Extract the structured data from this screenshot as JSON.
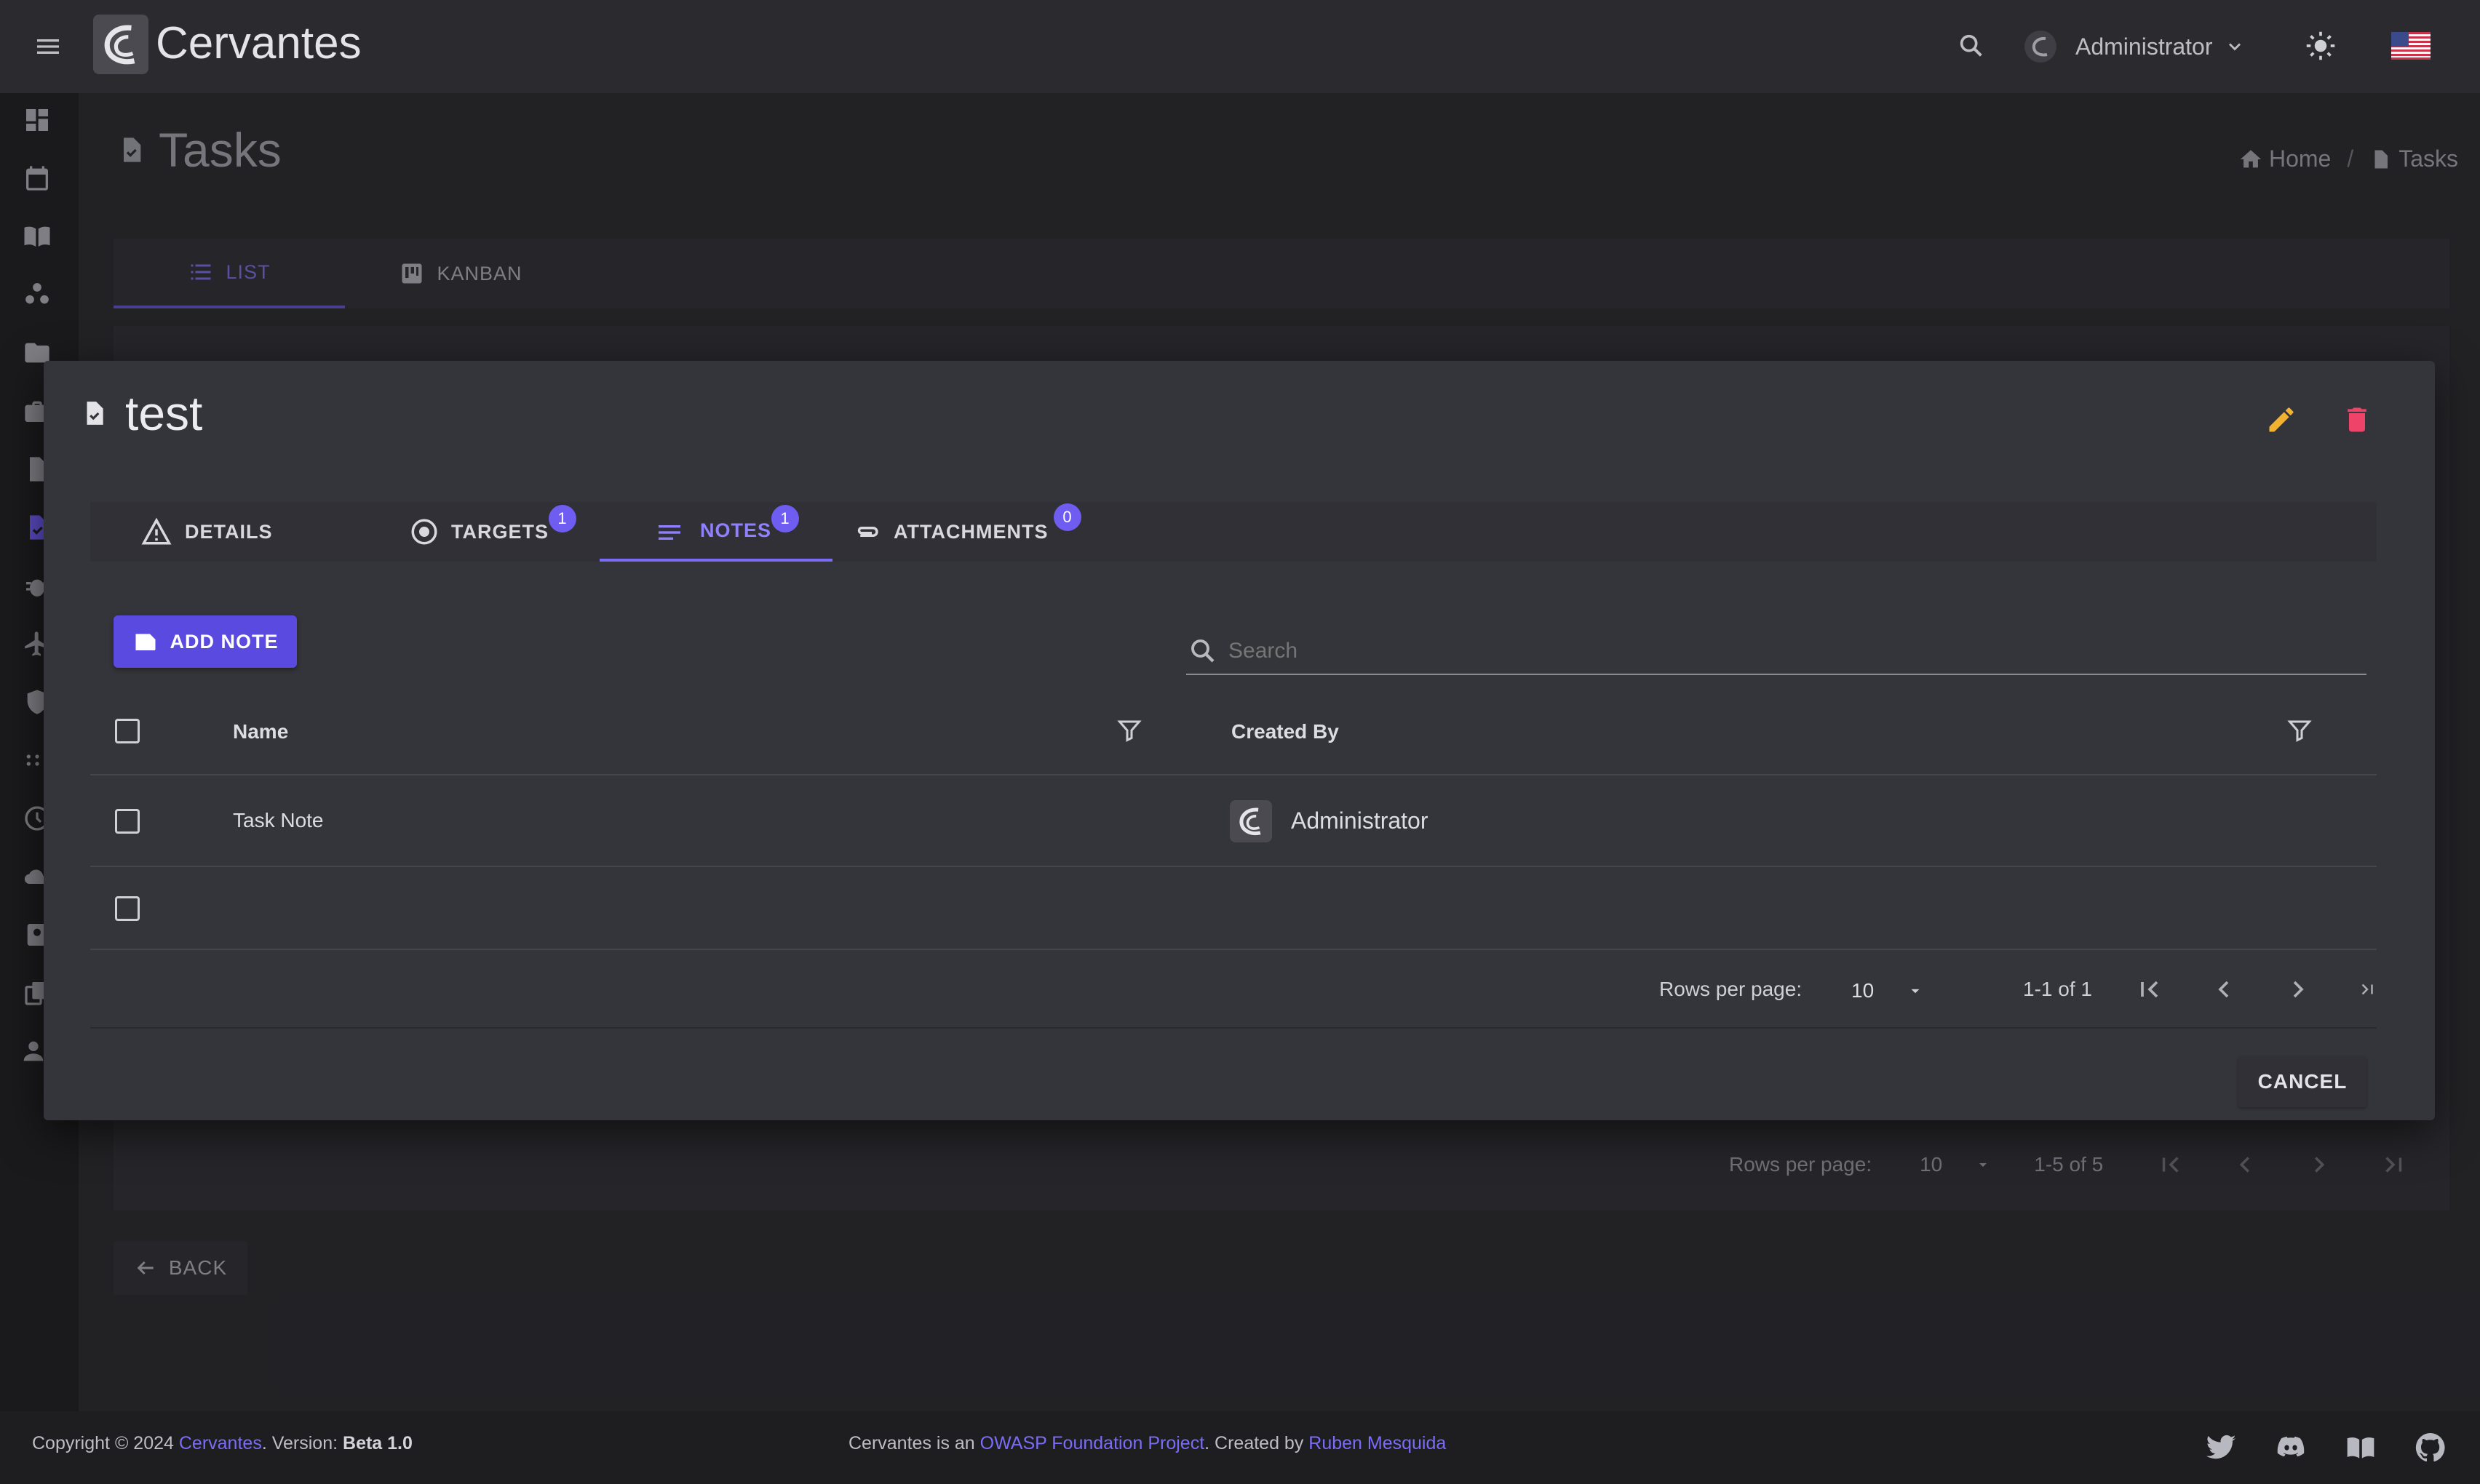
{
  "app": {
    "title": "Cervantes",
    "user": "Administrator"
  },
  "page": {
    "title": "Tasks"
  },
  "breadcrumb": {
    "home": "Home",
    "current": "Tasks"
  },
  "view_tabs": {
    "list": "LIST",
    "kanban": "KANBAN"
  },
  "background_pagination": {
    "rows_label": "Rows per page:",
    "rows_value": "10",
    "range": "1-5 of 5"
  },
  "back_label": "BACK",
  "modal": {
    "title": "test",
    "tabs": [
      {
        "label": "DETAILS"
      },
      {
        "label": "TARGETS",
        "badge": "1"
      },
      {
        "label": "NOTES",
        "badge": "1"
      },
      {
        "label": "ATTACHMENTS",
        "badge": "0"
      }
    ],
    "add_note_label": "ADD NOTE",
    "search_placeholder": "Search",
    "table": {
      "headers": [
        "Name",
        "Created By"
      ],
      "rows": [
        {
          "name": "Task Note",
          "created_by": "Administrator"
        }
      ]
    },
    "pagination": {
      "rows_label": "Rows per page:",
      "rows_value": "10",
      "range": "1-1 of 1"
    },
    "cancel_label": "CANCEL"
  },
  "footer": {
    "copyright_prefix": "Copyright © 2024",
    "brand": "Cervantes",
    "version_prefix": ". Version:",
    "version": "Beta 1.0",
    "project_prefix": "Cervantes is an",
    "project_link": "OWASP Foundation Project",
    "created_by_prefix": ". Created by",
    "author": "Ruben Mesquida"
  },
  "colors": {
    "accent": "#6f5cf0",
    "link": "#7b6cf6",
    "edit": "#f2b230",
    "delete": "#f0436a"
  }
}
